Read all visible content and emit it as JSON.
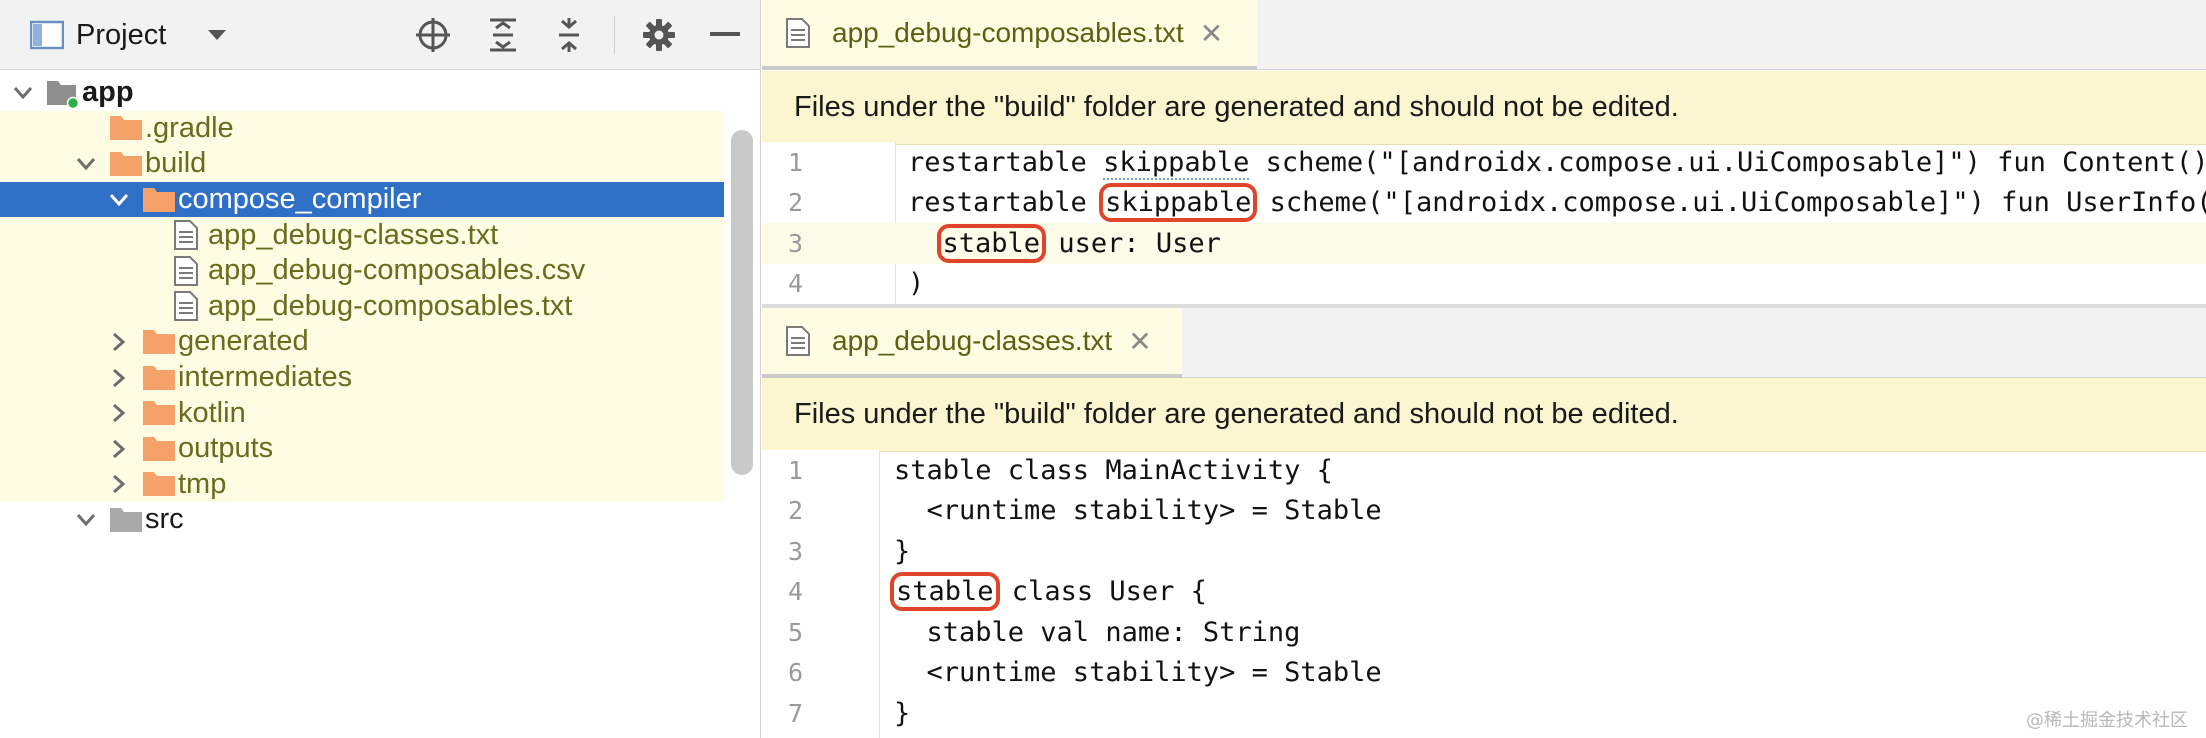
{
  "project_panel": {
    "title": "Project",
    "tree": [
      {
        "label": "app",
        "level": 0,
        "expanded": true,
        "icon": "module-folder-icon"
      },
      {
        "label": ".gradle",
        "level": 1,
        "expanded": null,
        "icon": "folder-icon"
      },
      {
        "label": "build",
        "level": 1,
        "expanded": true,
        "icon": "folder-icon"
      },
      {
        "label": "compose_compiler",
        "level": 2,
        "expanded": true,
        "icon": "folder-icon",
        "selected": true
      },
      {
        "label": "app_debug-classes.txt",
        "level": 3,
        "expanded": null,
        "icon": "text-file-icon"
      },
      {
        "label": "app_debug-composables.csv",
        "level": 3,
        "expanded": null,
        "icon": "text-file-icon"
      },
      {
        "label": "app_debug-composables.txt",
        "level": 3,
        "expanded": null,
        "icon": "text-file-icon"
      },
      {
        "label": "generated",
        "level": 2,
        "expanded": false,
        "icon": "folder-icon"
      },
      {
        "label": "intermediates",
        "level": 2,
        "expanded": false,
        "icon": "folder-icon"
      },
      {
        "label": "kotlin",
        "level": 2,
        "expanded": false,
        "icon": "folder-icon"
      },
      {
        "label": "outputs",
        "level": 2,
        "expanded": false,
        "icon": "folder-icon"
      },
      {
        "label": "tmp",
        "level": 2,
        "expanded": false,
        "icon": "folder-icon"
      },
      {
        "label": "src",
        "level": 1,
        "expanded": true,
        "icon": "gray-folder-icon"
      }
    ]
  },
  "editor_top": {
    "tab_title": "app_debug-composables.txt",
    "close_glyph": "✕",
    "banner": "Files under the \"build\" folder are generated and should not be edited.",
    "lines": [
      {
        "num": "1",
        "parts": [
          "restartable ",
          "skippable",
          " scheme(\"[androidx.compose.ui.UiComposable]\") fun Content()"
        ]
      },
      {
        "num": "2",
        "parts": [
          "restartable ",
          "skippable",
          " scheme(\"[androidx.compose.ui.UiComposable]\") fun UserInfo("
        ]
      },
      {
        "num": "3",
        "parts": [
          "  ",
          "stable",
          " user: User"
        ]
      },
      {
        "num": "4",
        "parts": [
          ")"
        ]
      }
    ]
  },
  "editor_bottom": {
    "tab_title": "app_debug-classes.txt",
    "close_glyph": "✕",
    "banner": "Files under the \"build\" folder are generated and should not be edited.",
    "lines": [
      {
        "num": "1",
        "parts": [
          "stable class MainActivity {"
        ]
      },
      {
        "num": "2",
        "parts": [
          "  <runtime stability> = Stable"
        ]
      },
      {
        "num": "3",
        "parts": [
          "}"
        ]
      },
      {
        "num": "4",
        "parts": [
          "stable",
          " class User {"
        ]
      },
      {
        "num": "5",
        "parts": [
          "  stable val name: String"
        ]
      },
      {
        "num": "6",
        "parts": [
          "  <runtime stability> = Stable"
        ]
      },
      {
        "num": "7",
        "parts": [
          "}"
        ]
      }
    ]
  },
  "watermark": "@稀土掘金技术社区",
  "colors": {
    "selection": "#2f6fc6",
    "build_highlight": "#fefde3",
    "banner": "#fbf5d0",
    "annotation_box": "#e0452c",
    "folder": "#f4a26a"
  }
}
